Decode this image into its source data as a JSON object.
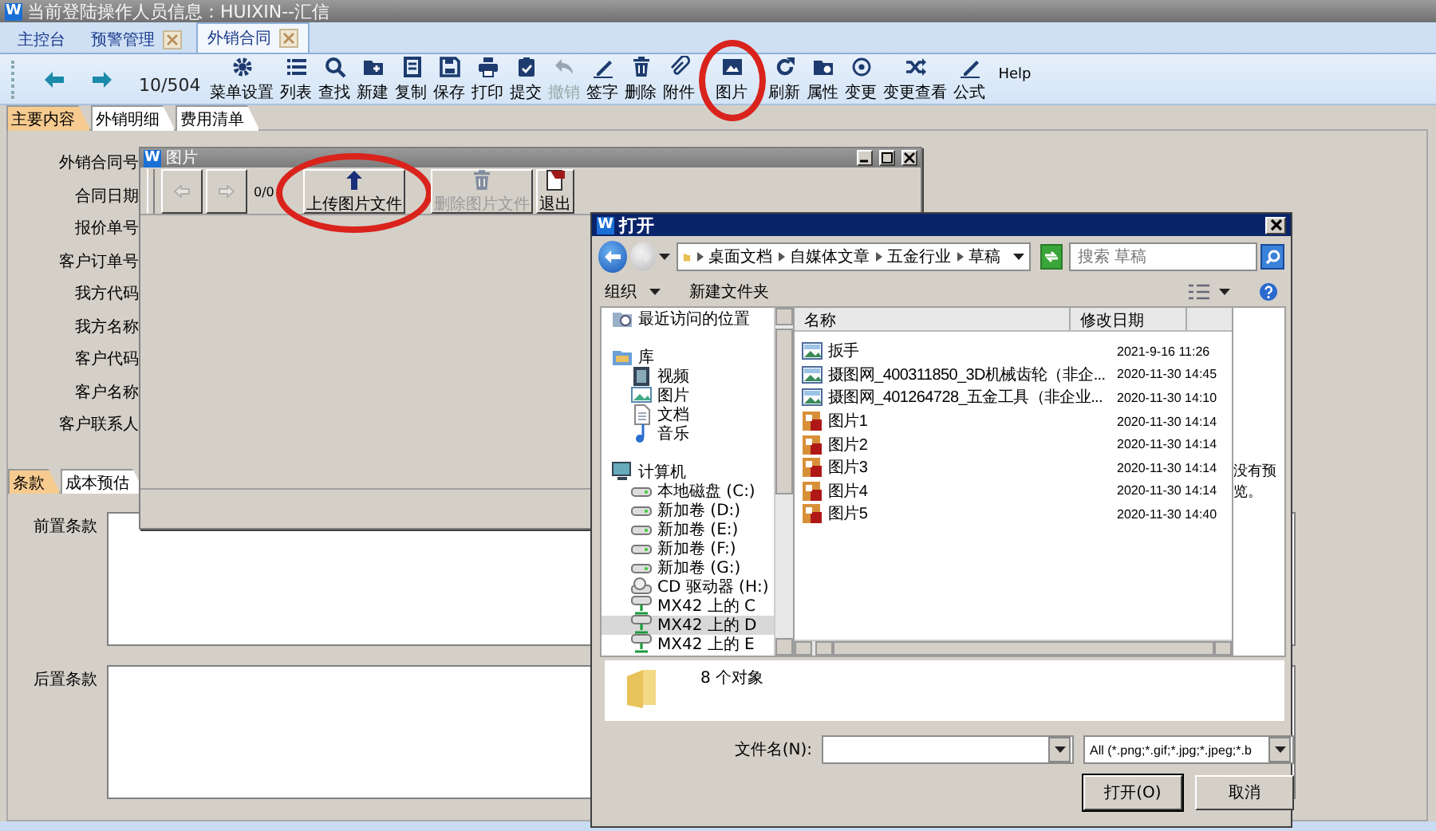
{
  "title_bar": {
    "logo": "W",
    "title": "当前登陆操作人员信息：HUIXIN--汇信"
  },
  "tabs": [
    {
      "label": "主控台",
      "closable": false,
      "selected": false
    },
    {
      "label": "预警管理",
      "closable": true,
      "selected": false
    },
    {
      "label": "外销合同",
      "closable": true,
      "selected": true
    }
  ],
  "record_counter": "10/504",
  "toolbar": [
    {
      "label": "菜单设置",
      "kind": "gear",
      "disabled": false,
      "circled": false
    },
    {
      "label": "列表",
      "kind": "list",
      "disabled": false,
      "circled": false
    },
    {
      "label": "查找",
      "kind": "search",
      "disabled": false,
      "circled": false
    },
    {
      "label": "新建",
      "kind": "new",
      "disabled": false,
      "circled": false
    },
    {
      "label": "复制",
      "kind": "copy",
      "disabled": false,
      "circled": false
    },
    {
      "label": "保存",
      "kind": "save",
      "disabled": false,
      "circled": false
    },
    {
      "label": "打印",
      "kind": "print",
      "disabled": false,
      "circled": false
    },
    {
      "label": "提交",
      "kind": "submit",
      "disabled": false,
      "circled": false
    },
    {
      "label": "撤销",
      "kind": "undo",
      "disabled": true,
      "circled": false
    },
    {
      "label": "签字",
      "kind": "sign",
      "disabled": false,
      "circled": false
    },
    {
      "label": "删除",
      "kind": "delete",
      "disabled": false,
      "circled": false
    },
    {
      "label": "附件",
      "kind": "attach",
      "disabled": false,
      "circled": false
    },
    {
      "label": "图片",
      "kind": "image",
      "disabled": false,
      "circled": true
    },
    {
      "label": "刷新",
      "kind": "refresh",
      "disabled": false,
      "circled": false
    },
    {
      "label": "属性",
      "kind": "props",
      "disabled": false,
      "circled": false
    },
    {
      "label": "变更",
      "kind": "change",
      "disabled": false,
      "circled": false
    },
    {
      "label": "变更查看",
      "kind": "history",
      "disabled": false,
      "circled": false
    },
    {
      "label": "公式",
      "kind": "formula",
      "disabled": false,
      "circled": false
    }
  ],
  "help": "Help",
  "section_tabs": [
    {
      "label": "主要内容",
      "selected": true
    },
    {
      "label": "外销明细",
      "selected": false
    },
    {
      "label": "费用清单",
      "selected": false
    }
  ],
  "form_fields": [
    "外销合同号",
    "合同日期",
    "报价单号",
    "客户订单号",
    "我方代码",
    "我方名称",
    "客户代码",
    "客户名称",
    "客户联系人"
  ],
  "clause_tabs": [
    {
      "label": "条款",
      "selected": true
    },
    {
      "label": "成本预估",
      "selected": false
    }
  ],
  "clause_fields": [
    "前置条款",
    "后置条款"
  ],
  "picture_dialog": {
    "logo": "W",
    "title": "图片",
    "counter": "0/0",
    "buttons": [
      {
        "label": "上传图片文件",
        "kind": "upload",
        "disabled": false,
        "circled": true
      },
      {
        "label": "删除图片文件",
        "kind": "delete",
        "disabled": true,
        "circled": false
      },
      {
        "label": "退出",
        "kind": "exit",
        "disabled": false,
        "circled": false
      }
    ]
  },
  "open_dialog": {
    "logo": "W",
    "title": "打开",
    "breadcrumb": [
      "桌面文档",
      "自媒体文章",
      "五金行业",
      "草稿"
    ],
    "search": {
      "placeholder": "搜索 草稿"
    },
    "commands": [
      {
        "label": "组织",
        "dropdown": true
      },
      {
        "label": "新建文件夹",
        "dropdown": false
      }
    ],
    "tree": [
      {
        "label": "最近访问的位置",
        "kind": "recent",
        "selected": false
      },
      {
        "label": "库",
        "kind": "library",
        "selected": false,
        "children": [
          {
            "label": "视频",
            "kind": "video",
            "selected": false
          },
          {
            "label": "图片",
            "kind": "pictures",
            "selected": false
          },
          {
            "label": "文档",
            "kind": "docs",
            "selected": false
          },
          {
            "label": "音乐",
            "kind": "music",
            "selected": false
          }
        ]
      },
      {
        "label": "计算机",
        "kind": "computer",
        "selected": false,
        "children": [
          {
            "label": "本地磁盘 (C:)",
            "kind": "drive",
            "selected": false
          },
          {
            "label": "新加卷 (D:)",
            "kind": "drive",
            "selected": false
          },
          {
            "label": "新加卷 (E:)",
            "kind": "drive",
            "selected": false
          },
          {
            "label": "新加卷 (F:)",
            "kind": "drive",
            "selected": false
          },
          {
            "label": "新加卷 (G:)",
            "kind": "drive",
            "selected": false
          },
          {
            "label": "CD 驱动器 (H:)",
            "kind": "cdrom",
            "selected": false
          },
          {
            "label": "MX42 上的 C",
            "kind": "network",
            "selected": false
          },
          {
            "label": "MX42 上的 D",
            "kind": "network",
            "selected": true
          },
          {
            "label": "MX42 上的 E",
            "kind": "network",
            "selected": false
          }
        ]
      }
    ],
    "columns": [
      "名称",
      "修改日期"
    ],
    "files": [
      {
        "name": "扳手",
        "kind": "image",
        "modified": "2021-9-16 11:26"
      },
      {
        "name": "摄图网_400311850_3D机械齿轮（非企...",
        "kind": "image",
        "modified": "2020-11-30 14:45"
      },
      {
        "name": "摄图网_401264728_五金工具（非企业...",
        "kind": "image",
        "modified": "2020-11-30 14:10"
      },
      {
        "name": "图片1",
        "kind": "photo",
        "modified": "2020-11-30 14:14"
      },
      {
        "name": "图片2",
        "kind": "photo",
        "modified": "2020-11-30 14:14"
      },
      {
        "name": "图片3",
        "kind": "photo",
        "modified": "2020-11-30 14:14"
      },
      {
        "name": "图片4",
        "kind": "photo",
        "modified": "2020-11-30 14:14"
      },
      {
        "name": "图片5",
        "kind": "photo",
        "modified": "2020-11-30 14:40"
      }
    ],
    "preview_text": "没有预览。",
    "item_count": "8 个对象",
    "filename_label": "文件名(N):",
    "file_type": "All (*.png;*.gif;*.jpg;*.jpeg;*.b",
    "buttons": [
      {
        "label": "打开(O)",
        "default": true
      },
      {
        "label": "取消",
        "default": false
      }
    ]
  }
}
